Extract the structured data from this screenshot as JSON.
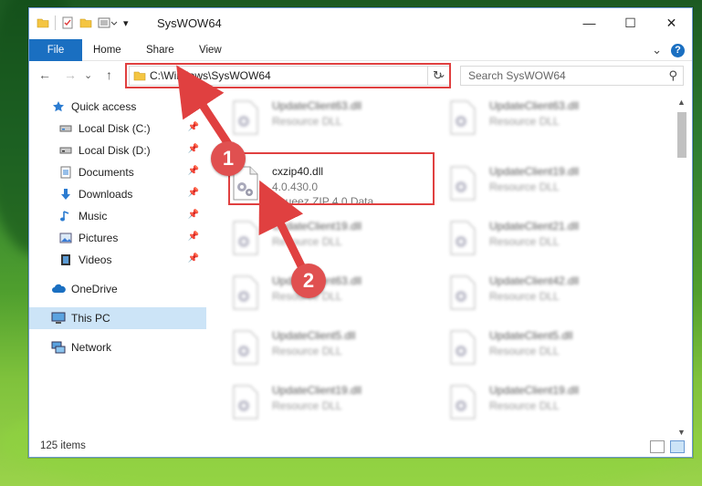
{
  "window": {
    "title": "SysWOW64",
    "min_glyph": "—",
    "max_glyph": "☐",
    "close_glyph": "✕"
  },
  "ribbon": {
    "tabs": [
      "File",
      "Home",
      "Share",
      "View"
    ],
    "expand_glyph": "⌄",
    "help_glyph": "?"
  },
  "navigation": {
    "back_glyph": "←",
    "forward_glyph": "→",
    "recent_glyph": "⌄",
    "up_glyph": "↑",
    "address": "C:\\Windows\\SysWOW64",
    "address_dropdown_glyph": "⌄",
    "refresh_glyph": "↻",
    "search_placeholder": "Search SysWOW64",
    "search_glyph": "⚲"
  },
  "sidebar": {
    "items": [
      {
        "label": "Quick access",
        "icon": "star-icon",
        "pinned": false
      },
      {
        "label": "Local Disk (C:)",
        "icon": "drive-icon",
        "pinned": true
      },
      {
        "label": "Local Disk (D:)",
        "icon": "drive-icon",
        "pinned": true
      },
      {
        "label": "Documents",
        "icon": "documents-icon",
        "pinned": true
      },
      {
        "label": "Downloads",
        "icon": "download-icon",
        "pinned": true
      },
      {
        "label": "Music",
        "icon": "music-icon",
        "pinned": true
      },
      {
        "label": "Pictures",
        "icon": "pictures-icon",
        "pinned": true
      },
      {
        "label": "Videos",
        "icon": "videos-icon",
        "pinned": true
      },
      {
        "label": "OneDrive",
        "icon": "cloud-icon",
        "pinned": false
      },
      {
        "label": "This PC",
        "icon": "computer-icon",
        "pinned": false,
        "selected": true
      },
      {
        "label": "Network",
        "icon": "network-icon",
        "pinned": false
      }
    ],
    "pin_glyph": "📌"
  },
  "files": {
    "left": [
      {
        "name": "UpdateClient63.dll",
        "line2": "Resource DLL",
        "line3": ""
      },
      {
        "name": "cxzip40.dll",
        "line2": "4.0.430.0",
        "line3": "Squeez ZIP 4.0 Data..."
      },
      {
        "name": "UpdateClient19.dll",
        "line2": "Resource DLL",
        "line3": ""
      },
      {
        "name": "UpdateClient63.dll",
        "line2": "Resource DLL",
        "line3": ""
      },
      {
        "name": "UpdateClient5.dll",
        "line2": "Resource DLL",
        "line3": ""
      },
      {
        "name": "UpdateClient19.dll",
        "line2": "Resource DLL",
        "line3": ""
      }
    ],
    "right": [
      {
        "name": "UpdateClient63.dll",
        "line2": "Resource DLL"
      },
      {
        "name": "UpdateClient19.dll",
        "line2": "Resource DLL"
      },
      {
        "name": "UpdateClient21.dll",
        "line2": "Resource DLL"
      },
      {
        "name": "UpdateClient42.dll",
        "line2": "Resource DLL"
      },
      {
        "name": "UpdateClient5.dll",
        "line2": "Resource DLL"
      },
      {
        "name": "UpdateClient19.dll",
        "line2": "Resource DLL"
      }
    ]
  },
  "status": {
    "item_count": "125 items"
  },
  "annotations": {
    "marker1": "1",
    "marker2": "2",
    "color": "#e04040"
  },
  "colors": {
    "accent": "#1a6fc1",
    "selection": "#cce4f7"
  }
}
